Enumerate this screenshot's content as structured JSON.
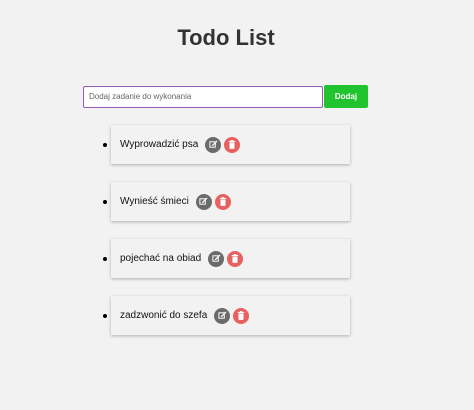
{
  "header": {
    "title": "Todo List"
  },
  "form": {
    "placeholder": "Dodaj zadanie do wykonania",
    "value": "",
    "add_label": "Dodaj"
  },
  "tasks": [
    {
      "text": "Wyprowadzić psa"
    },
    {
      "text": "Wynieść śmieci"
    },
    {
      "text": "pojechać na obiad"
    },
    {
      "text": "zadzwonić do szefa"
    }
  ],
  "icons": {
    "edit": "edit-icon",
    "delete": "trash-icon"
  },
  "colors": {
    "background": "#f2f2f2",
    "input_border": "#9b59b6",
    "add_button": "#21c42f",
    "edit_button": "#6b6b6b",
    "delete_button": "#e86060"
  }
}
